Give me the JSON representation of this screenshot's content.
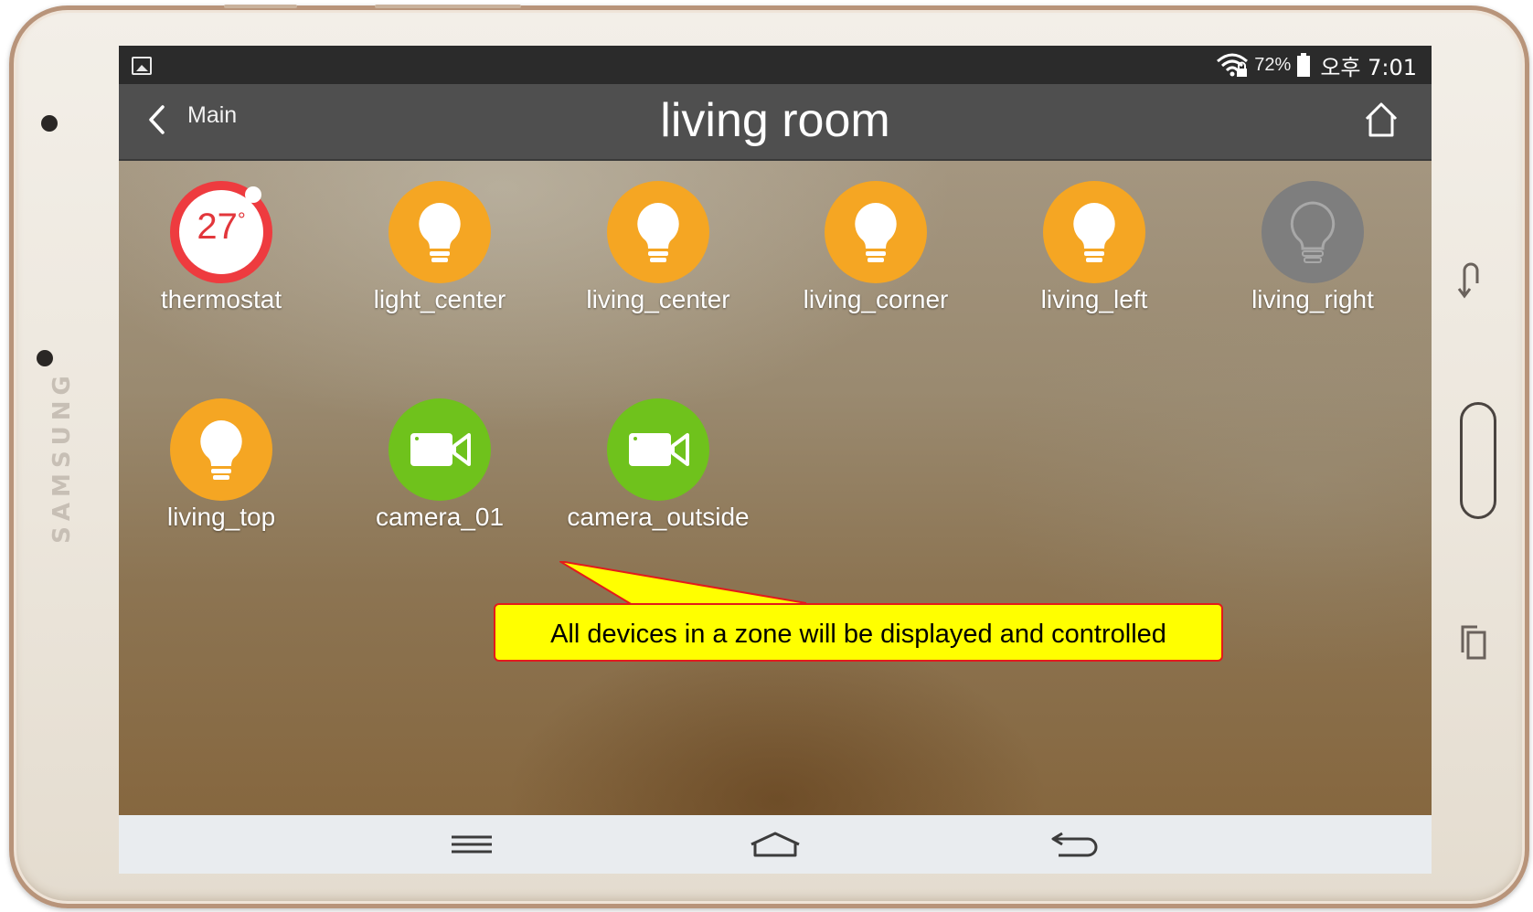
{
  "device_frame": {
    "brand": "SAMSUNG"
  },
  "status_bar": {
    "battery_percent": "72%",
    "time": "오후 7:01"
  },
  "app_bar": {
    "back_label": "Main",
    "title": "living room"
  },
  "devices": [
    {
      "label": "thermostat",
      "type": "thermostat",
      "value": "27",
      "unit": "°",
      "color": "#ee3b3f"
    },
    {
      "label": "light_center",
      "type": "light",
      "state": "on",
      "color": "#f5a623"
    },
    {
      "label": "living_center",
      "type": "light",
      "state": "on",
      "color": "#f5a623"
    },
    {
      "label": "living_corner",
      "type": "light",
      "state": "on",
      "color": "#f5a623"
    },
    {
      "label": "living_left",
      "type": "light",
      "state": "on",
      "color": "#f5a623"
    },
    {
      "label": "living_right",
      "type": "light",
      "state": "off",
      "color": "#7e7e7e"
    },
    {
      "label": "living_top",
      "type": "light",
      "state": "on",
      "color": "#f5a623"
    },
    {
      "label": "camera_01",
      "type": "camera",
      "color": "#6fc21c"
    },
    {
      "label": "camera_outside",
      "type": "camera",
      "color": "#6fc21c"
    }
  ],
  "annotation": {
    "text": "All devices in a zone will be displayed and controlled",
    "background": "#ffff00",
    "border": "#e21b1b"
  },
  "nav_bar": {
    "icons": [
      "menu-icon",
      "home-icon",
      "back-icon"
    ]
  }
}
